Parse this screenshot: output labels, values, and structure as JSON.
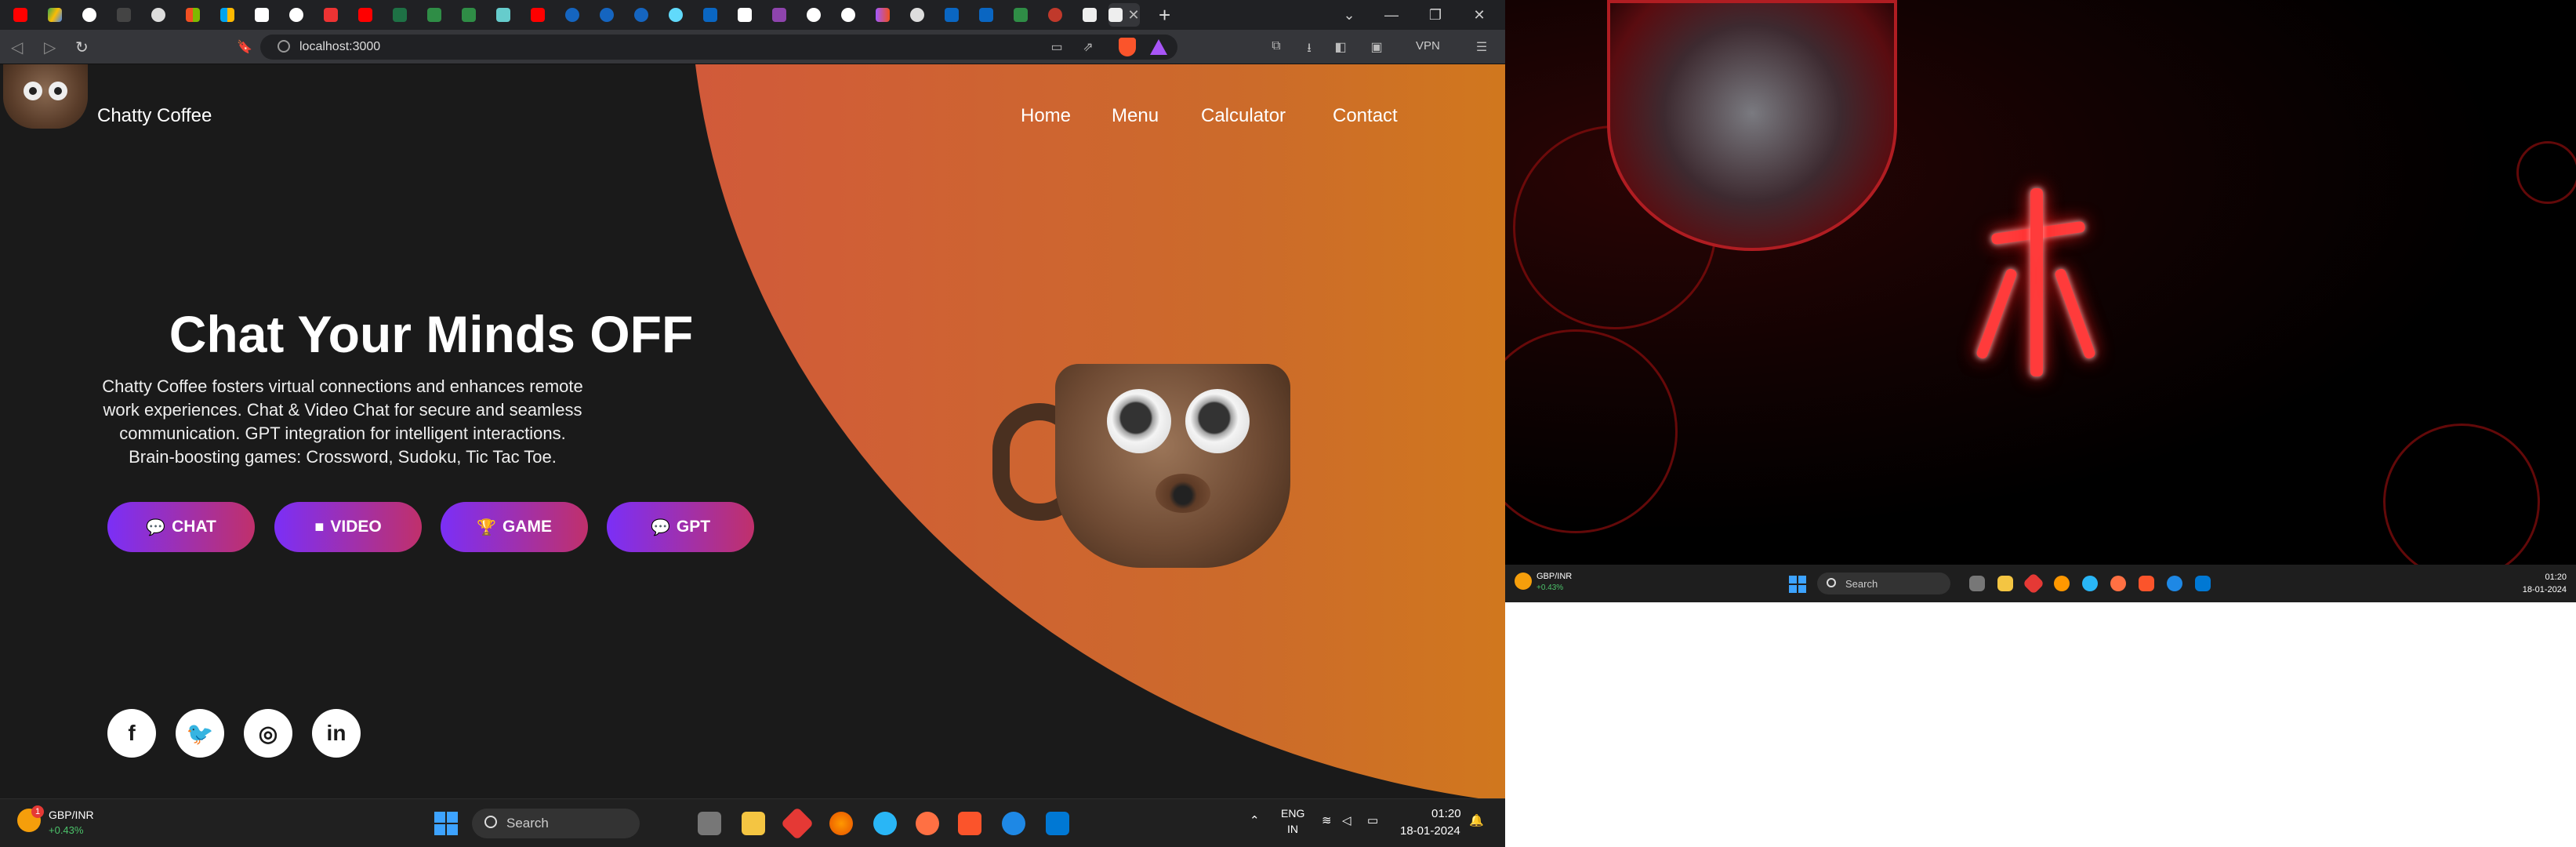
{
  "browser": {
    "url": "localhost:3000",
    "vpn_label": "VPN",
    "new_tab": "+",
    "tab_close": "✕"
  },
  "site": {
    "brand": "Chatty Coffee",
    "nav": [
      "Home",
      "Menu",
      "Calculator",
      "Contact"
    ],
    "hero_title": "Chat Your Minds OFF",
    "hero_text": "Chatty Coffee fosters virtual connections and enhances remote work experiences. Chat & Video Chat for secure and seamless communication. GPT integration for intelligent interactions. Brain-boosting games: Crossword, Sudoku, Tic Tac Toe.",
    "buttons": [
      {
        "label": "CHAT",
        "icon": "comments-icon"
      },
      {
        "label": "VIDEO",
        "icon": "video-camera-icon"
      },
      {
        "label": "GAME",
        "icon": "trophy-icon"
      },
      {
        "label": "GPT",
        "icon": "comment-dots-icon"
      }
    ],
    "social": [
      {
        "name": "facebook-icon",
        "glyph": "f"
      },
      {
        "name": "twitter-icon",
        "glyph": "🐦"
      },
      {
        "name": "instagram-icon",
        "glyph": "◎"
      },
      {
        "name": "linkedin-icon",
        "glyph": "in"
      }
    ],
    "colors": {
      "background": "#1a1a1a",
      "arc_start": "#d15a3a",
      "arc_end": "#e09a0a",
      "button_start": "#7b2ff7",
      "button_end": "#c0306b"
    }
  },
  "taskbar_left": {
    "ticker_name": "GBP/INR",
    "ticker_value": "+0.43%",
    "ticker_badge": "1",
    "search_placeholder": "Search",
    "lang_top": "ENG",
    "lang_bottom": "IN",
    "time": "01:20",
    "date": "18-01-2024"
  },
  "taskbar_right": {
    "ticker_name": "GBP/INR",
    "ticker_value": "+0.43%",
    "search_placeholder": "Search",
    "time": "01:20",
    "date": "18-01-2024"
  }
}
